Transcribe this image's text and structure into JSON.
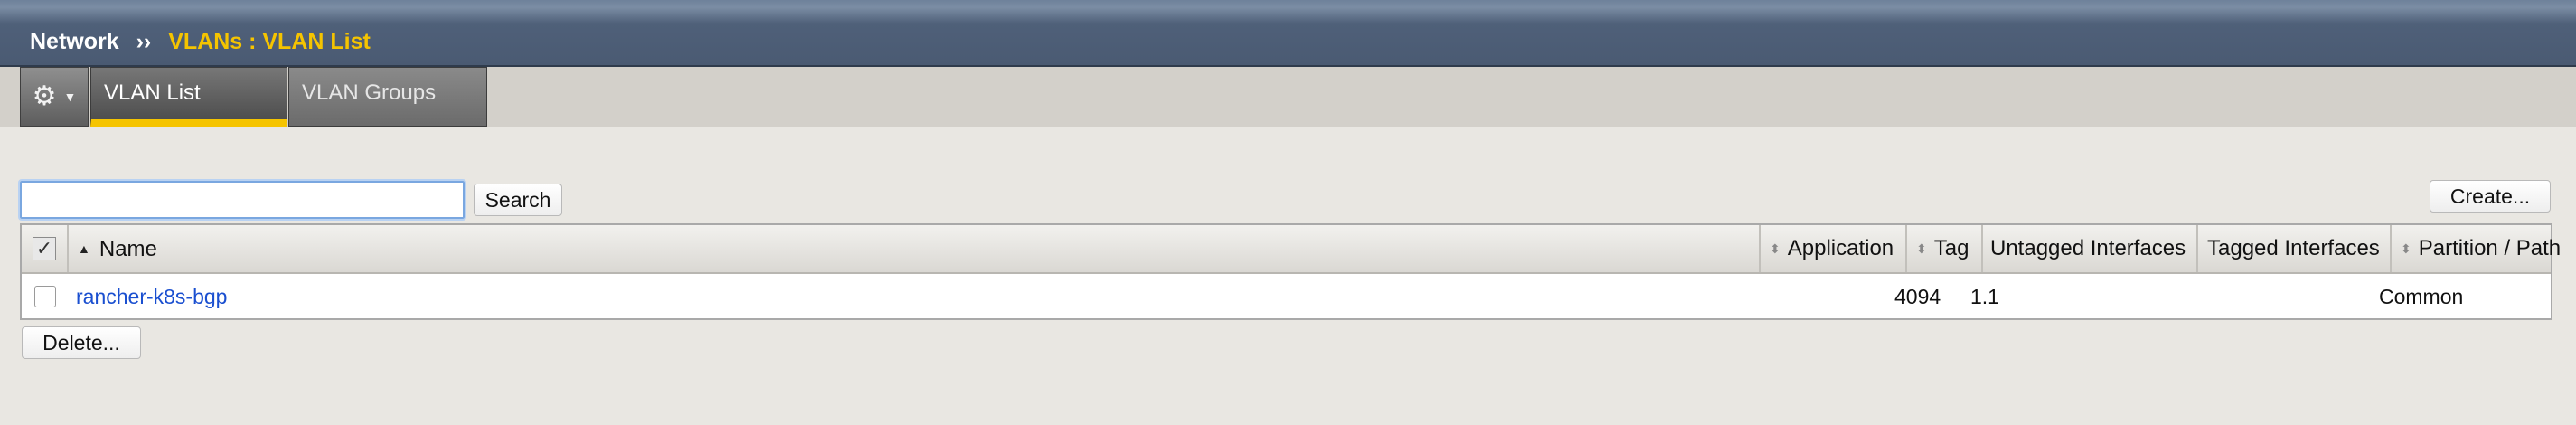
{
  "breadcrumb": {
    "root": "Network",
    "separator": "››",
    "current": "VLANs : VLAN List"
  },
  "tabs": {
    "gear_icon": "gear-icon",
    "items": [
      {
        "label": "VLAN List",
        "active": true
      },
      {
        "label": "VLAN Groups",
        "active": false
      }
    ]
  },
  "search": {
    "value": "",
    "button_label": "Search"
  },
  "actions": {
    "create_label": "Create...",
    "delete_label": "Delete..."
  },
  "table": {
    "columns": [
      "Name",
      "Application",
      "Tag",
      "Untagged Interfaces",
      "Tagged Interfaces",
      "Partition / Path"
    ],
    "rows": [
      {
        "name": "rancher-k8s-bgp",
        "application": "",
        "tag": "4094",
        "untagged_interfaces": "1.1",
        "tagged_interfaces": "",
        "partition_path": "Common"
      }
    ]
  },
  "colors": {
    "accent": "#f5c400",
    "link": "#1a4fd0",
    "header_bar": "#4a5a72"
  }
}
